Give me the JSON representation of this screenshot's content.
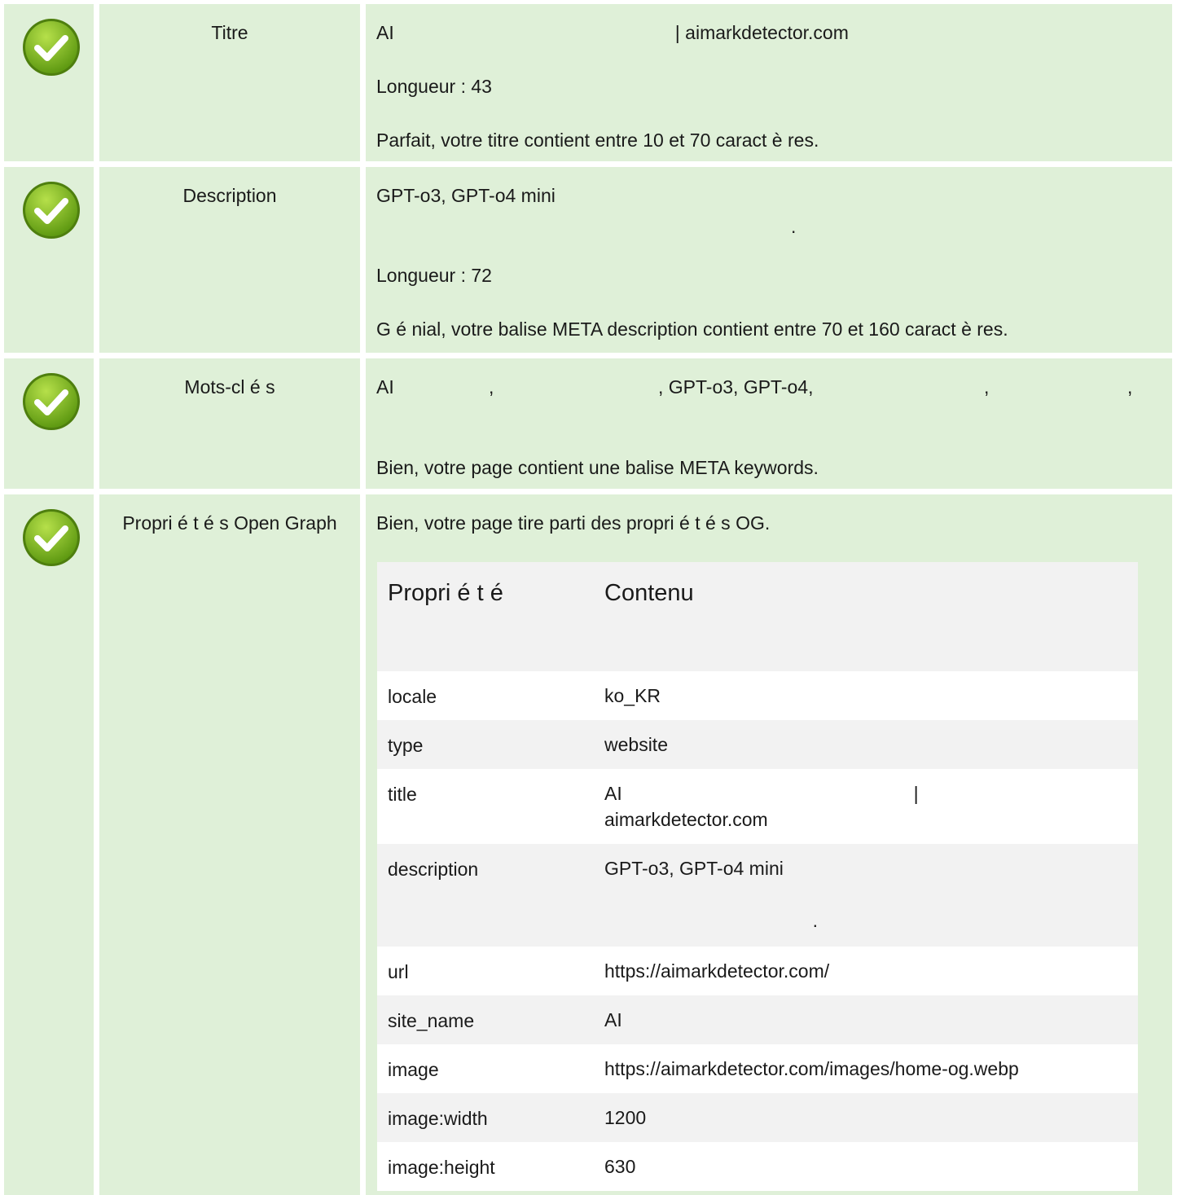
{
  "rows": [
    {
      "label": "Titre",
      "value_line1": "AI                                                      | aimarkdetector.com",
      "length": "Longueur : 43",
      "message": "Parfait, votre titre contient entre 10 et 70 caract è res."
    },
    {
      "label": "Description",
      "value_line1": "GPT-o3, GPT-o4 mini",
      "value_line2": ".",
      "length": "Longueur : 72",
      "message": "G é nial, votre balise META description contient entre 70 et 160 caract è res."
    },
    {
      "label": "Mots-cl é s",
      "keywords": [
        "AI",
        ",",
        ", GPT-o3, GPT-o4,",
        ",",
        ","
      ],
      "message": "Bien, votre page contient une balise META keywords."
    },
    {
      "label": "Propri é t é s Open Graph",
      "message": "Bien, votre page tire parti des propri é t é s OG."
    }
  ],
  "og_table": {
    "header_property": "Propri é t é",
    "header_content": "Contenu",
    "rows": [
      {
        "key": "locale",
        "value": "ko_KR"
      },
      {
        "key": "type",
        "value": "website"
      },
      {
        "key": "title",
        "value": "AI                                                        |\naimarkdetector.com"
      },
      {
        "key": "description",
        "value": "GPT-o3, GPT-o4 mini\n\n                                        ."
      },
      {
        "key": "url",
        "value": "https://aimarkdetector.com/"
      },
      {
        "key": "site_name",
        "value": "AI"
      },
      {
        "key": "image",
        "value": "https://aimarkdetector.com/images/home-og.webp"
      },
      {
        "key": "image:width",
        "value": "1200"
      },
      {
        "key": "image:height",
        "value": "630"
      }
    ]
  },
  "colors": {
    "row_background": "#dff0d8",
    "check_green": "#7ab51d",
    "table_stripe": "#f2f2f2"
  }
}
